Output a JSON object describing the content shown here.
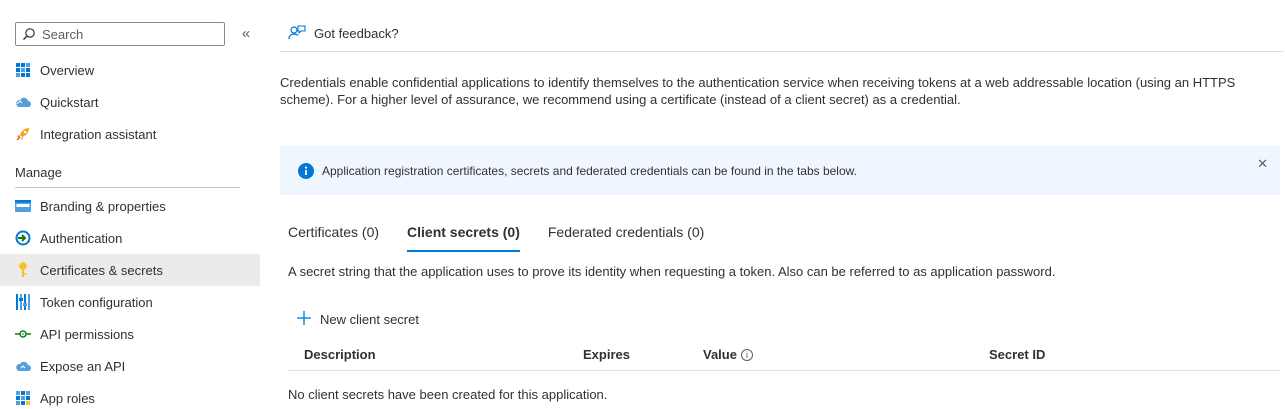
{
  "sidebar": {
    "search": {
      "placeholder": "Search"
    },
    "collapse_label": "«",
    "items": [
      {
        "label": "Overview",
        "icon": "overview-grid-icon"
      },
      {
        "label": "Quickstart",
        "icon": "cloud-icon"
      },
      {
        "label": "Integration assistant",
        "icon": "rocket-icon"
      }
    ],
    "manage_label": "Manage",
    "manage_items": [
      {
        "label": "Branding & properties",
        "icon": "branding-icon"
      },
      {
        "label": "Authentication",
        "icon": "authentication-icon"
      },
      {
        "label": "Certificates & secrets",
        "icon": "key-icon",
        "active": true
      },
      {
        "label": "Token configuration",
        "icon": "token-bars-icon"
      },
      {
        "label": "API permissions",
        "icon": "api-permissions-icon"
      },
      {
        "label": "Expose an API",
        "icon": "cloud-api-icon"
      },
      {
        "label": "App roles",
        "icon": "app-roles-icon"
      }
    ]
  },
  "toolbar": {
    "feedback_label": "Got feedback?"
  },
  "intro_text": "Credentials enable confidential applications to identify themselves to the authentication service when receiving tokens at a web addressable location (using an HTTPS scheme). For a higher level of assurance, we recommend using a certificate (instead of a client secret) as a credential.",
  "infobar": {
    "message": "Application registration certificates, secrets and federated credentials can be found in the tabs below.",
    "close_label": "✕"
  },
  "tabs": [
    {
      "label": "Certificates (0)",
      "active": false
    },
    {
      "label": "Client secrets (0)",
      "active": true
    },
    {
      "label": "Federated credentials (0)",
      "active": false
    }
  ],
  "tab_description": "A secret string that the application uses to prove its identity when requesting a token. Also can be referred to as application password.",
  "new_secret_label": "New client secret",
  "table": {
    "columns": [
      "Description",
      "Expires",
      "Value",
      "Secret ID"
    ],
    "empty_message": "No client secrets have been created for this application."
  },
  "colors": {
    "accent": "#0078d4",
    "active_nav_bg": "#edebe9",
    "infobar_bg": "#f0f6ff"
  }
}
